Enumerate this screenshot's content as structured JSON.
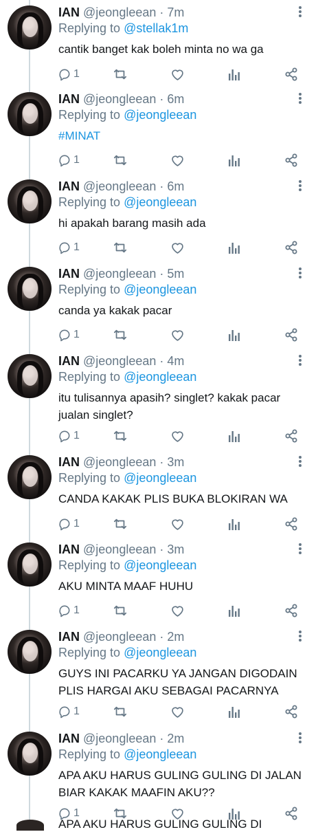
{
  "colors": {
    "text": "#14171a",
    "secondary": "#657786",
    "link": "#1b95e0",
    "thread_line": "#cfd9de",
    "background": "#ffffff"
  },
  "icons": {
    "reply": "comment-bubble-icon",
    "retweet": "retweet-icon",
    "like": "heart-icon",
    "analytics": "analytics-bars-icon",
    "share": "share-icon",
    "more": "vertical-dots-icon"
  },
  "tweets": [
    {
      "name": "IAN",
      "handle": "@jeongleean",
      "time": "· 7m",
      "replying_prefix": "Replying to ",
      "replying_to": "@stellak1m",
      "text": "cantik banget kak boleh minta no wa ga",
      "reply_count": "1"
    },
    {
      "name": "IAN",
      "handle": "@jeongleean",
      "time": "· 6m",
      "replying_prefix": "Replying to ",
      "replying_to": "@jeongleean",
      "text": "#MINAT",
      "reply_count": "1"
    },
    {
      "name": "IAN",
      "handle": "@jeongleean",
      "time": "· 6m",
      "replying_prefix": "Replying to ",
      "replying_to": "@jeongleean",
      "text": "hi apakah barang masih ada",
      "reply_count": "1"
    },
    {
      "name": "IAN",
      "handle": "@jeongleean",
      "time": "· 5m",
      "replying_prefix": "Replying to ",
      "replying_to": "@jeongleean",
      "text": "canda ya kakak pacar",
      "reply_count": "1"
    },
    {
      "name": "IAN",
      "handle": "@jeongleean",
      "time": "· 4m",
      "replying_prefix": "Replying to ",
      "replying_to": "@jeongleean",
      "text": "itu tulisannya apasih? singlet? kakak pacar jualan singlet?",
      "reply_count": "1"
    },
    {
      "name": "IAN",
      "handle": "@jeongleean",
      "time": "· 3m",
      "replying_prefix": "Replying to ",
      "replying_to": "@jeongleean",
      "text": "CANDA KAKAK PLIS BUKA BLOKIRAN WA",
      "reply_count": "1"
    },
    {
      "name": "IAN",
      "handle": "@jeongleean",
      "time": "· 3m",
      "replying_prefix": "Replying to ",
      "replying_to": "@jeongleean",
      "text": "AKU MINTA MAAF HUHU",
      "reply_count": "1"
    },
    {
      "name": "IAN",
      "handle": "@jeongleean",
      "time": "· 2m",
      "replying_prefix": "Replying to ",
      "replying_to": "@jeongleean",
      "text": "GUYS INI PACARKU YA JANGAN DIGODAIN PLIS HARGAI AKU SEBAGAI PACARNYA",
      "reply_count": "1"
    },
    {
      "name": "IAN",
      "handle": "@jeongleean",
      "time": "· 2m",
      "replying_prefix": "Replying to ",
      "replying_to": "@jeongleean",
      "text": "APA AKU HARUS GULING GULING DI JALAN BIAR KAKAK MAAFIN AKU??",
      "reply_count": "1"
    }
  ],
  "cutoff_text": "APA AKU HARUS GULING GULING DI"
}
